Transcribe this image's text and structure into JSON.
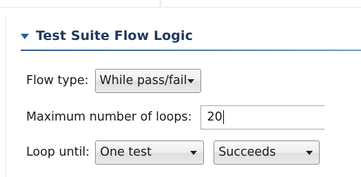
{
  "section": {
    "title": "Test Suite Flow Logic"
  },
  "flow_type": {
    "label": "Flow type:",
    "selected": "While pass/fail"
  },
  "max_loops": {
    "label": "Maximum number of loops:",
    "value": "20"
  },
  "loop_until": {
    "label": "Loop until:",
    "target_selected": "One test",
    "condition_selected": "Succeeds"
  },
  "colors": {
    "header_text": "#1e3a5c",
    "twisty": "#275f9a",
    "underline": "#2a5b8e"
  },
  "icons": {
    "section_toggle": "expanded-triangle-icon",
    "dropdown": "dropdown-arrow-icon"
  }
}
